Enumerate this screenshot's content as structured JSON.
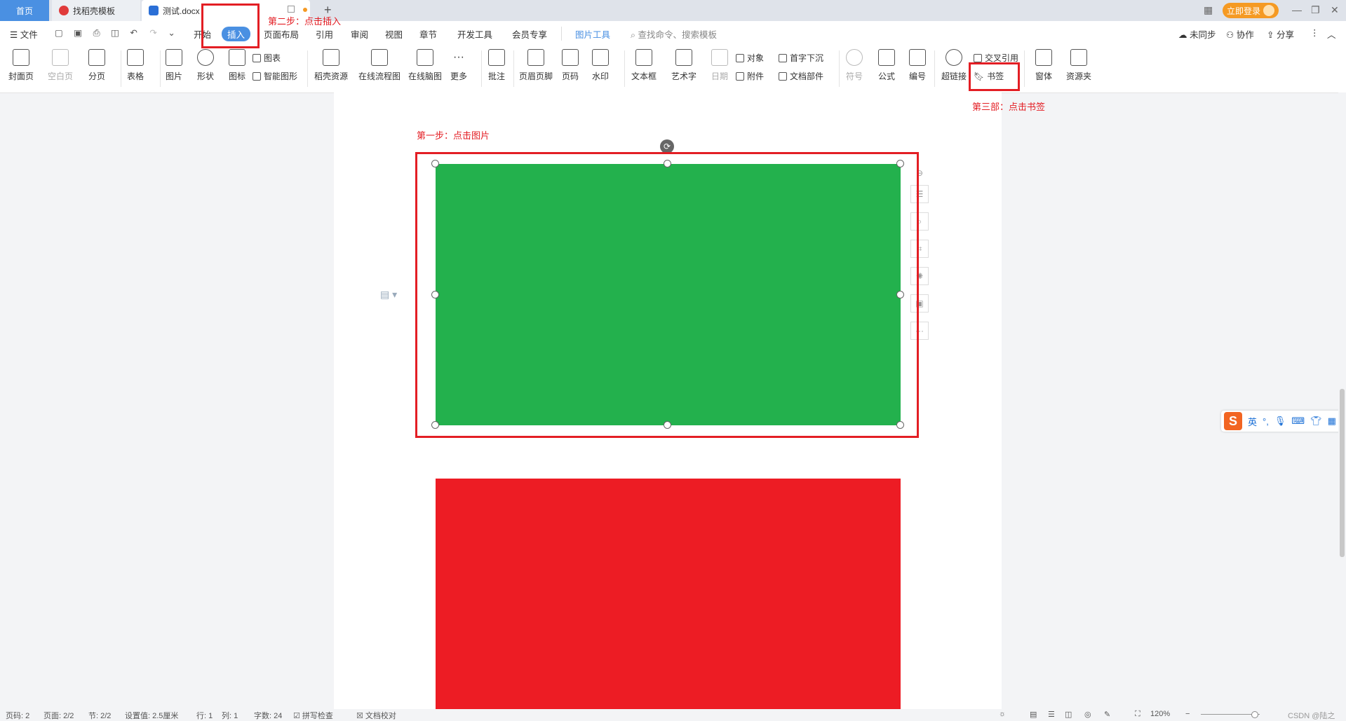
{
  "tabbar": {
    "home": "首页",
    "tab2": "找稻壳模板",
    "tab3": "测试.docx",
    "login": "立即登录"
  },
  "menubar": {
    "file": "文件",
    "items": [
      "开始",
      "插入",
      "页面布局",
      "引用",
      "审阅",
      "视图",
      "章节",
      "开发工具",
      "会员专享"
    ],
    "picture_tools": "图片工具",
    "search_placeholder": "查找命令、搜索模板",
    "sync": "未同步",
    "collab": "协作",
    "share": "分享"
  },
  "ribbon": {
    "cover": "封面页",
    "blank": "空白页",
    "break": "分页",
    "table": "表格",
    "picture": "图片",
    "shape": "形状",
    "icon": "图标",
    "chart": "图表",
    "smartart": "智能图形",
    "docer": "稻壳资源",
    "flowchart": "在线流程图",
    "mindmap": "在线脑图",
    "more": "更多",
    "comment": "批注",
    "headerfooter": "页眉页脚",
    "pagenum": "页码",
    "watermark": "水印",
    "textbox": "文本框",
    "wordart": "艺术字",
    "date": "日期",
    "object": "对象",
    "attachment": "附件",
    "dropcap": "首字下沉",
    "docparts": "文档部件",
    "symbol": "符号",
    "formula": "公式",
    "numbering": "编号",
    "hyperlink": "超链接",
    "crossref": "交叉引用",
    "bookmark": "书签",
    "window": "窗体",
    "resources": "资源夹"
  },
  "annotations": {
    "step1": "第一步：点击图片",
    "step2": "第二步：点击插入",
    "step3": "第三部：点击书签"
  },
  "colors": {
    "green_image": "#23b14d",
    "red_image": "#ed1c24",
    "annotation_red": "#e31e24",
    "accent": "#4a90e2"
  },
  "ime": {
    "mode": "英"
  },
  "statusbar": {
    "page": "页码: 2",
    "pages": "页面: 2/2",
    "section": "节: 2/2",
    "setting": "设置值: 2.5厘米",
    "row": "行: 1",
    "col": "列: 1",
    "wordcount": "字数: 24",
    "spellcheck": "拼写检查",
    "proof": "文档校对",
    "zoom": "120%",
    "watermark": "CSDN @陆之"
  }
}
